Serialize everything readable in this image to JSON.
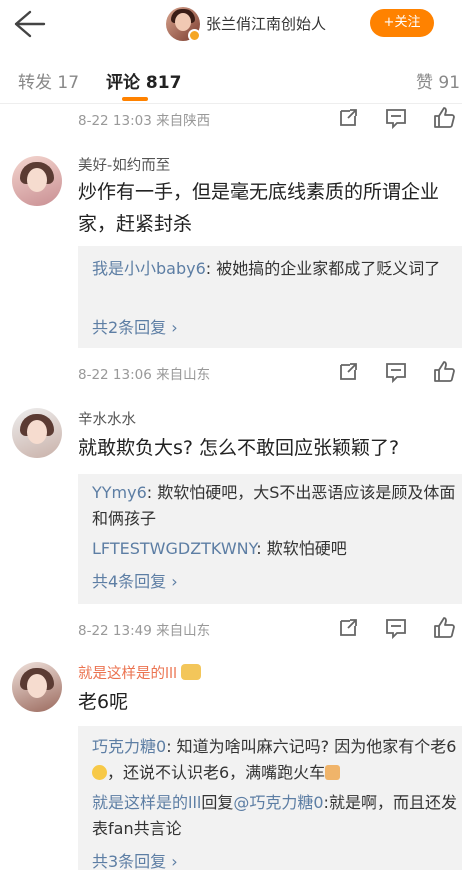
{
  "header": {
    "back_icon": "back-arrow-icon",
    "account_name": "张兰俏江南创始人",
    "follow_label": "+关注",
    "accent_color": "#ff8200"
  },
  "tabs": [
    {
      "label": "转发 17",
      "active": false
    },
    {
      "label": "评论 817",
      "active": true
    },
    {
      "label": "赞 91",
      "active": false
    }
  ],
  "top_meta": {
    "text": "8-22 13:03 来自陕西"
  },
  "comments": [
    {
      "user": "美好-如约而至",
      "content": "炒作有一手，但是毫无底线素质的所谓企业家，赶紧封杀",
      "replies": [
        {
          "user": "我是小小baby6",
          "text": ": 被她搞的企业家都成了贬义词了"
        }
      ],
      "more_replies": "共2条回复 ›",
      "meta": "8-22 13:06 来自山东"
    },
    {
      "user": "辛水水水",
      "content": "就敢欺负大s? 怎么不敢回应张颖颖了?",
      "replies": [
        {
          "user": "YYmy6",
          "text": ": 欺软怕硬吧，大S不出恶语应该是顾及体面和俩孩子"
        },
        {
          "user": "LFTESTWGDZTKWNY",
          "text": ": 欺软怕硬吧"
        }
      ],
      "more_replies": "共4条回复 ›",
      "meta": "8-22 13:49 来自山东"
    },
    {
      "user": "就是这样是的lll",
      "content": "老6呢",
      "replies": [
        {
          "user": "巧克力糖0",
          "text": ": 知道为啥叫麻六记吗? 因为他家有个老6",
          "text_after": "，还说不认识老6，满嘴跑火车"
        },
        {
          "user": "就是这样是的lll",
          "middle": "回复",
          "mention": "@巧克力糖0",
          "text": ":就是啊，而且还发表fan共言论"
        }
      ],
      "more_replies": "共3条回复 ›"
    }
  ],
  "action_icons": [
    "share-icon",
    "comment-icon",
    "like-icon"
  ]
}
